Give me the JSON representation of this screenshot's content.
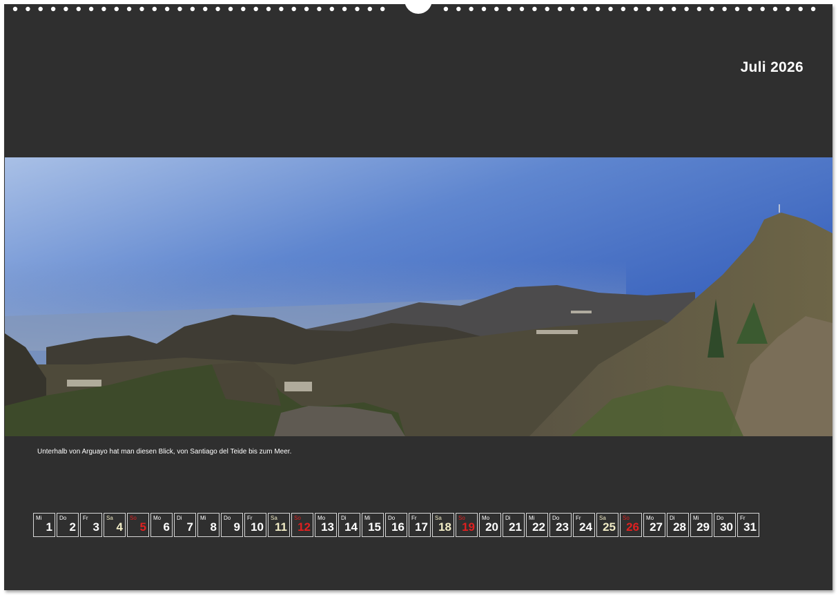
{
  "calendar": {
    "month_title": "Juli 2026",
    "caption": "Unterhalb von Arguayo hat man diesen Blick, von Santiago del Teide bis zum Meer.",
    "photo_subject": "mountain-valley-panorama",
    "colors": {
      "background": "#2f2f2f",
      "weekday_text": "#ffffff",
      "saturday_text": "#f1ecc6",
      "sunday_text": "#e02020"
    },
    "days": [
      {
        "wd": "Mi",
        "n": "1",
        "type": "weekday"
      },
      {
        "wd": "Do",
        "n": "2",
        "type": "weekday"
      },
      {
        "wd": "Fr",
        "n": "3",
        "type": "weekday"
      },
      {
        "wd": "Sa",
        "n": "4",
        "type": "sat"
      },
      {
        "wd": "So",
        "n": "5",
        "type": "sun"
      },
      {
        "wd": "Mo",
        "n": "6",
        "type": "weekday"
      },
      {
        "wd": "Di",
        "n": "7",
        "type": "weekday"
      },
      {
        "wd": "Mi",
        "n": "8",
        "type": "weekday"
      },
      {
        "wd": "Do",
        "n": "9",
        "type": "weekday"
      },
      {
        "wd": "Fr",
        "n": "10",
        "type": "weekday"
      },
      {
        "wd": "Sa",
        "n": "11",
        "type": "sat"
      },
      {
        "wd": "So",
        "n": "12",
        "type": "sun"
      },
      {
        "wd": "Mo",
        "n": "13",
        "type": "weekday"
      },
      {
        "wd": "Di",
        "n": "14",
        "type": "weekday"
      },
      {
        "wd": "Mi",
        "n": "15",
        "type": "weekday"
      },
      {
        "wd": "Do",
        "n": "16",
        "type": "weekday"
      },
      {
        "wd": "Fr",
        "n": "17",
        "type": "weekday"
      },
      {
        "wd": "Sa",
        "n": "18",
        "type": "sat"
      },
      {
        "wd": "So",
        "n": "19",
        "type": "sun"
      },
      {
        "wd": "Mo",
        "n": "20",
        "type": "weekday"
      },
      {
        "wd": "Di",
        "n": "21",
        "type": "weekday"
      },
      {
        "wd": "Mi",
        "n": "22",
        "type": "weekday"
      },
      {
        "wd": "Do",
        "n": "23",
        "type": "weekday"
      },
      {
        "wd": "Fr",
        "n": "24",
        "type": "weekday"
      },
      {
        "wd": "Sa",
        "n": "25",
        "type": "sat"
      },
      {
        "wd": "So",
        "n": "26",
        "type": "sun"
      },
      {
        "wd": "Mo",
        "n": "27",
        "type": "weekday"
      },
      {
        "wd": "Di",
        "n": "28",
        "type": "weekday"
      },
      {
        "wd": "Mi",
        "n": "29",
        "type": "weekday"
      },
      {
        "wd": "Do",
        "n": "30",
        "type": "weekday"
      },
      {
        "wd": "Fr",
        "n": "31",
        "type": "weekday"
      }
    ]
  }
}
